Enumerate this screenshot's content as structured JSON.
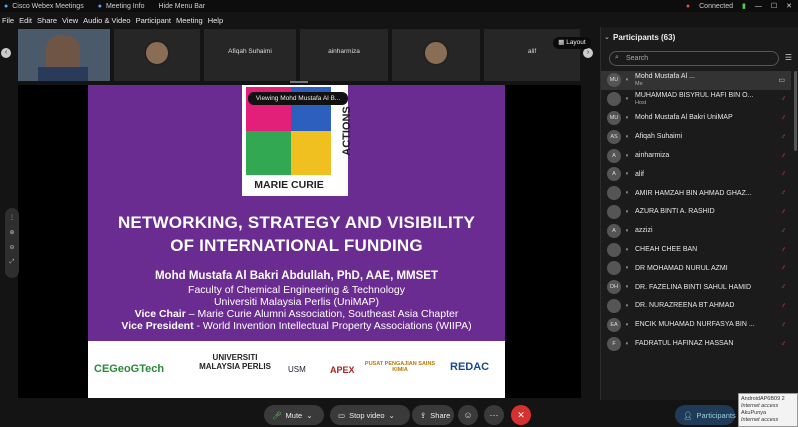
{
  "window": {
    "title": "Cisco Webex Meetings",
    "meeting_info": "Meeting Info",
    "hide_menu": "Hide Menu Bar",
    "connected": "Connected"
  },
  "menu": [
    "File",
    "Edit",
    "Share",
    "View",
    "Audio & Video",
    "Participant",
    "Meeting",
    "Help"
  ],
  "thumbs": [
    {
      "name": "Afiqah Suhaimi"
    },
    {
      "name": "ainharmiza"
    },
    {
      "name": "alif"
    }
  ],
  "layout_label": "Layout",
  "viewing": "Viewing Mohd Mustafa Al B...",
  "slide": {
    "logo_text": "MARIE CURIE",
    "logo_side": "ACTIONS",
    "title1": "NETWORKING, STRATEGY AND VISIBILITY",
    "title2": "OF INTERNATIONAL FUNDING",
    "author": "Mohd Mustafa Al Bakri Abdullah, PhD, AAE, MMSET",
    "l1": "Faculty of Chemical Engineering & Technology",
    "l2": "Universiti Malaysia Perlis (UniMAP)",
    "l3a": "Vice Chair",
    "l3b": " – Marie Curie Alumni Association, Southeast Asia Chapter",
    "l4a": "Vice President",
    "l4b": " - World Invention Intellectual Property Associations (WIIPA)",
    "logos": [
      "CEGeoGTech",
      "UNIVERSITI MALAYSIA PERLIS",
      "USM",
      "APEX",
      "PUSAT PENGAJIAN SAINS KIMIA",
      "REDAC"
    ]
  },
  "controls": {
    "mute": "Mute",
    "video": "Stop video",
    "share": "Share",
    "participants": "Participants"
  },
  "panel": {
    "title": "Participants (63)",
    "search": "Search"
  },
  "participants": [
    {
      "i": "MU",
      "name": "Mohd Mustafa Al ...",
      "sub": "Me",
      "sel": true
    },
    {
      "i": "",
      "name": "MUHAMMAD BISYRUL HAFI BIN O...",
      "sub": "Host"
    },
    {
      "i": "MU",
      "name": "Mohd Mustafa Al Bakri UniMAP"
    },
    {
      "i": "AS",
      "name": "Afiqah Suhaimi"
    },
    {
      "i": "A",
      "name": "ainharmiza"
    },
    {
      "i": "A",
      "name": "alif"
    },
    {
      "i": "",
      "name": "AMIR HAMZAH BIN AHMAD GHAZ..."
    },
    {
      "i": "",
      "name": "AZURA BINTI A. RASHID"
    },
    {
      "i": "A",
      "name": "azzizi"
    },
    {
      "i": "",
      "name": "CHEAH CHEE BAN"
    },
    {
      "i": "",
      "name": "DR MOHAMAD NURUL AZMI"
    },
    {
      "i": "DH",
      "name": "DR. FAZELINA BINTI SAHUL HAMID"
    },
    {
      "i": "",
      "name": "DR. NURAZREENA BT AHMAD"
    },
    {
      "i": "EA",
      "name": "ENCIK MUHAMAD NURFASYA BIN ..."
    },
    {
      "i": "F",
      "name": "FADRATUL HAFINAZ HASSAN"
    }
  ],
  "toast": {
    "l1": "AndroidAP6B09 2",
    "l2": "Internet access",
    "l3": "AkuPunya",
    "l4": "Internet access"
  }
}
